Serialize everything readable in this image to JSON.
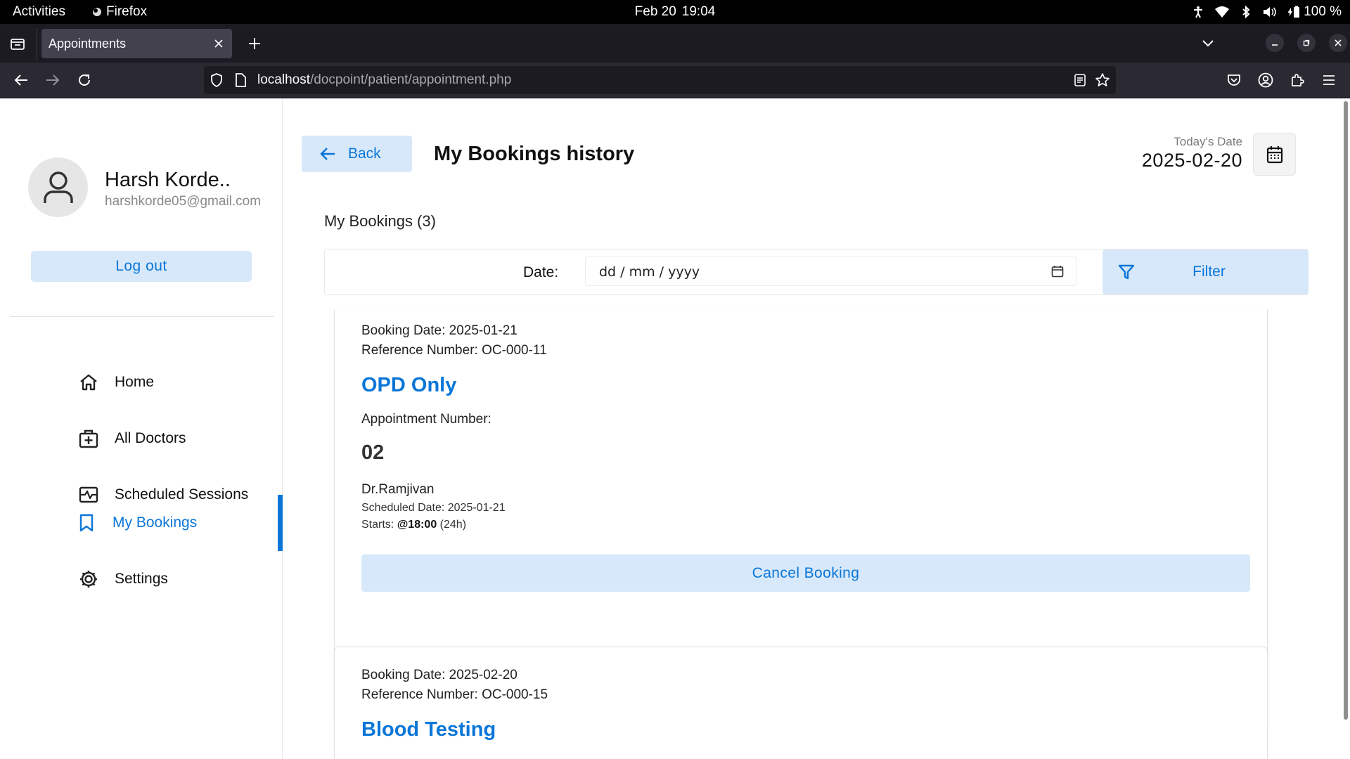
{
  "system_bar": {
    "activities": "Activities",
    "app_name": "Firefox",
    "date": "Feb 20",
    "time": "19:04",
    "battery": "100 %"
  },
  "browser": {
    "tab_title": "Appointments",
    "url_host": "localhost",
    "url_path": "/docpoint/patient/appointment.php"
  },
  "user": {
    "name": "Harsh Korde..",
    "email": "harshkorde05@gmail.com",
    "logout_label": "Log out"
  },
  "menu": {
    "items": [
      {
        "label": "Home",
        "icon": "home-icon"
      },
      {
        "label": "All Doctors",
        "icon": "doctor-bag-icon"
      },
      {
        "label": "Scheduled Sessions",
        "icon": "schedule-icon"
      },
      {
        "label": "My Bookings",
        "icon": "bookmark-icon",
        "active": true
      },
      {
        "label": "Settings",
        "icon": "gear-icon"
      }
    ]
  },
  "header": {
    "back_label": "Back",
    "title": "My Bookings history",
    "today_label": "Today's Date",
    "today_value": "2025-02-20"
  },
  "bookings": {
    "count_label": "My Bookings (3)",
    "filter": {
      "date_label": "Date:",
      "date_placeholder": "dd / mm / yyyy",
      "button_label": "Filter"
    },
    "cards": [
      {
        "booking_date": "Booking Date: 2025-01-21",
        "reference": "Reference Number: OC-000-11",
        "title": "OPD Only",
        "appointment_label": "Appointment Number:",
        "appointment_number": "02",
        "doctor": "Dr.Ramjivan",
        "scheduled_date": "Scheduled Date: 2025-01-21",
        "starts_prefix": "Starts: ",
        "starts_time": "@18:00",
        "starts_suffix": " (24h)",
        "cancel_label": "Cancel Booking"
      },
      {
        "booking_date": "Booking Date: 2025-02-20",
        "reference": "Reference Number: OC-000-15",
        "title": "Blood Testing"
      }
    ]
  },
  "colors": {
    "accent": "#0a76d8",
    "accent_light": "#d7e8fa",
    "chrome_dark": "#1c1b22",
    "toolbar": "#2b2a33"
  }
}
